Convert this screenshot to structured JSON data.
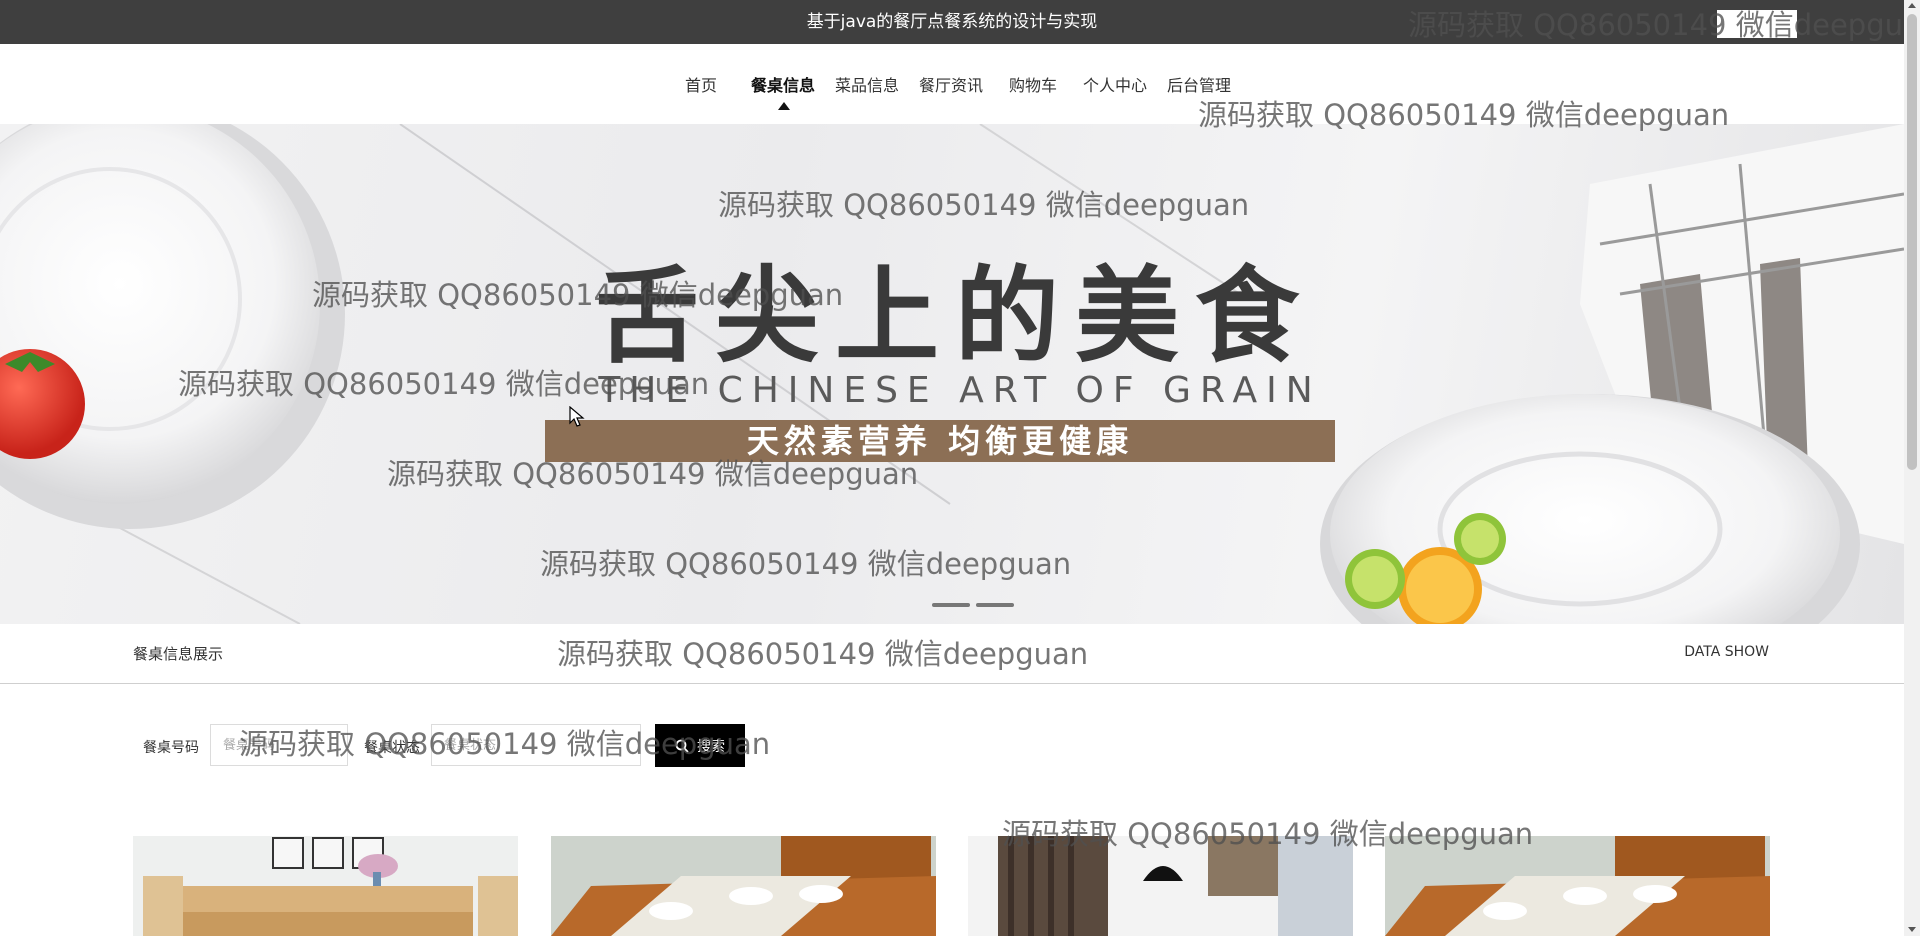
{
  "header": {
    "site_title": "基于java的餐厅点餐系统的设计与实现"
  },
  "nav": {
    "items": [
      {
        "label": "首页"
      },
      {
        "label": "餐桌信息"
      },
      {
        "label": "菜品信息"
      },
      {
        "label": "餐厅资讯"
      },
      {
        "label": "购物车"
      },
      {
        "label": "个人中心"
      },
      {
        "label": "后台管理"
      }
    ],
    "active": "餐桌信息"
  },
  "banner": {
    "title": "舌尖上的美食",
    "subtitle": "THE CHINESE ART OF GRAIN",
    "slogan": "天然素营养 均衡更健康",
    "slide_count": 2
  },
  "section": {
    "title": "餐桌信息展示",
    "title_en": "DATA SHOW"
  },
  "search": {
    "field1_label": "餐桌号码",
    "field1_placeholder": "餐桌号码",
    "field2_label": "餐桌状态",
    "field2_placeholder": "餐桌状态",
    "button_label": "搜索"
  },
  "cards": [
    {
      "name": "dining-table-photo-1"
    },
    {
      "name": "dining-table-photo-2"
    },
    {
      "name": "dining-table-photo-3"
    },
    {
      "name": "dining-table-photo-4"
    }
  ],
  "watermark": {
    "text": "源码获取 QQ86050149 微信deepguan"
  },
  "colors": {
    "topbar": "#3f3f3f",
    "button": "#000000",
    "slogan_band": "#8c6f55"
  }
}
